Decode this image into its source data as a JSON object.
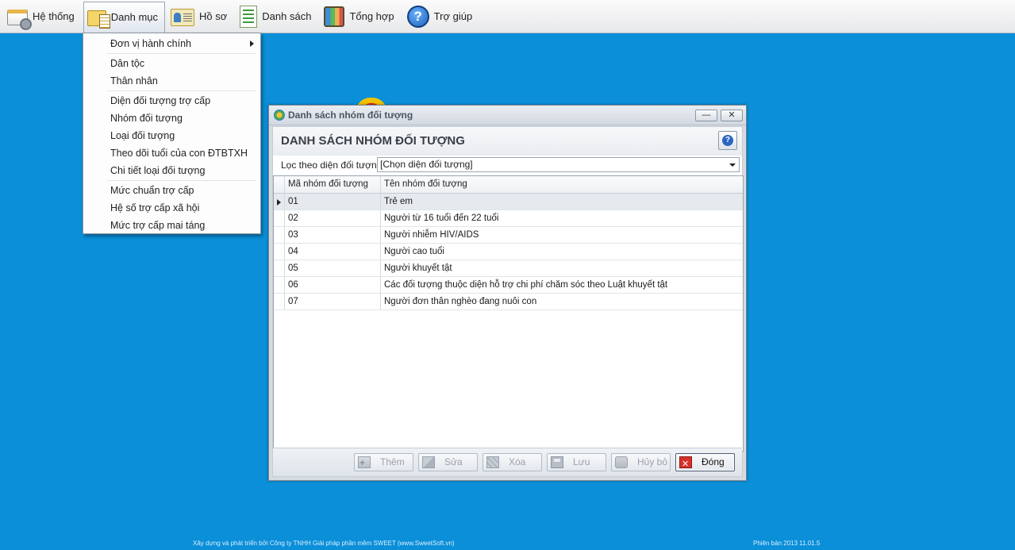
{
  "menubar": {
    "items": [
      {
        "label": "Hệ thống",
        "icon": "system-icon"
      },
      {
        "label": "Danh mục",
        "icon": "catalog-folder-icon"
      },
      {
        "label": "Hồ sơ",
        "icon": "profile-card-icon"
      },
      {
        "label": "Danh sách",
        "icon": "list-document-icon"
      },
      {
        "label": "Tổng hợp",
        "icon": "summary-books-icon"
      },
      {
        "label": "Trợ giúp",
        "icon": "help-icon"
      }
    ]
  },
  "dropdown": {
    "items": [
      "Đơn vị hành chính",
      "Dân tộc",
      "Thân nhân",
      "Diện đối tượng trợ cấp",
      "Nhóm đối tượng",
      "Loại đối tượng",
      "Theo dõi tuổi của con ĐTBTXH",
      "Chi tiết loại đối tượng",
      "Mức chuẩn trợ cấp",
      "Hệ số trợ cấp xã hội",
      "Mức trợ cấp mai táng"
    ]
  },
  "window": {
    "title": "Danh sách nhóm đối tượng",
    "heading": "DANH SÁCH NHÓM ĐỐI TƯỢNG",
    "filter_label": "Lọc theo diện đối tượng",
    "filter_value": "[Chọn diện đối tượng]",
    "columns": [
      "Mã nhóm đối tượng",
      "Tên nhóm đối tượng"
    ],
    "rows": [
      {
        "code": "01",
        "name": "Trẻ em"
      },
      {
        "code": "02",
        "name": "Người từ 16 tuổi đến 22 tuổi"
      },
      {
        "code": "03",
        "name": "Người nhiễm HIV/AIDS"
      },
      {
        "code": "04",
        "name": "Người cao tuổi"
      },
      {
        "code": "05",
        "name": "Người khuyết tật"
      },
      {
        "code": "06",
        "name": "Các đối tượng thuộc diện hỗ trợ chi phí chăm sóc theo Luật khuyết tật"
      },
      {
        "code": "07",
        "name": "Người đơn thân nghèo đang nuôi con"
      }
    ],
    "buttons": {
      "add": "Thêm",
      "edit": "Sửa",
      "delete": "Xóa",
      "save": "Lưu",
      "cancel": "Hủy bỏ",
      "close": "Đóng"
    }
  },
  "footer": {
    "credit": "Xây dựng và phát triển bởi Công ty TNHH Giải pháp phần mềm SWEET (www.SweetSoft.vn)",
    "version": "Phiên bản 2013 11.01.5"
  },
  "colors": {
    "desktop": "#0a8fd8",
    "menubar": "#e7e8ea",
    "window_frame": "#d6dbe2"
  }
}
